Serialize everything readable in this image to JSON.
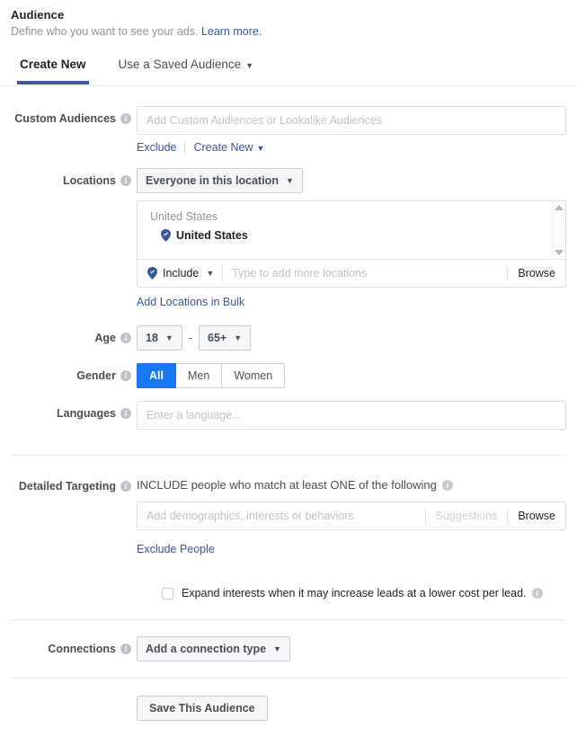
{
  "header": {
    "title": "Audience",
    "subtitle": "Define who you want to see your ads.",
    "learn_more": "Learn more."
  },
  "tabs": [
    {
      "label": "Create New",
      "active": true
    },
    {
      "label": "Use a Saved Audience",
      "active": false,
      "caret": "▼"
    }
  ],
  "custom_audiences": {
    "label": "Custom Audiences",
    "placeholder": "Add Custom Audiences or Lookalike Audiences",
    "exclude_link": "Exclude",
    "create_new_link": "Create New",
    "create_new_caret": "▼"
  },
  "locations": {
    "label": "Locations",
    "mode": "Everyone in this location",
    "mode_caret": "▼",
    "group_title": "United States",
    "selected": [
      {
        "name": "United States",
        "icon": "location-pin-icon"
      }
    ],
    "include_label": "Include",
    "include_caret": "▼",
    "input_placeholder": "Type to add more locations",
    "browse_label": "Browse",
    "bulk_link": "Add Locations in Bulk"
  },
  "age": {
    "label": "Age",
    "min": "18",
    "max": "65+",
    "separator": "-",
    "caret": "▼"
  },
  "gender": {
    "label": "Gender",
    "options": [
      {
        "label": "All",
        "selected": true
      },
      {
        "label": "Men",
        "selected": false
      },
      {
        "label": "Women",
        "selected": false
      }
    ]
  },
  "languages": {
    "label": "Languages",
    "placeholder": "Enter a language..."
  },
  "detailed_targeting": {
    "label": "Detailed Targeting",
    "heading": "INCLUDE people who match at least ONE of the following",
    "placeholder": "Add demographics, interests or behaviors",
    "suggestions_label": "Suggestions",
    "browse_label": "Browse",
    "exclude_link": "Exclude People"
  },
  "expand_interests": {
    "checked": false,
    "label": "Expand interests when it may increase leads at a lower cost per lead."
  },
  "connections": {
    "label": "Connections",
    "value": "Add a connection type",
    "caret": "▼"
  },
  "footer": {
    "save_label": "Save This Audience"
  },
  "colors": {
    "accent_blue": "#1877f2",
    "tab_underline": "#3b5998",
    "link": "#385898",
    "text_dark": "#1d2129",
    "text_muted": "#4b4f56",
    "placeholder": "#bec2c9",
    "border": "#dddfe2"
  }
}
